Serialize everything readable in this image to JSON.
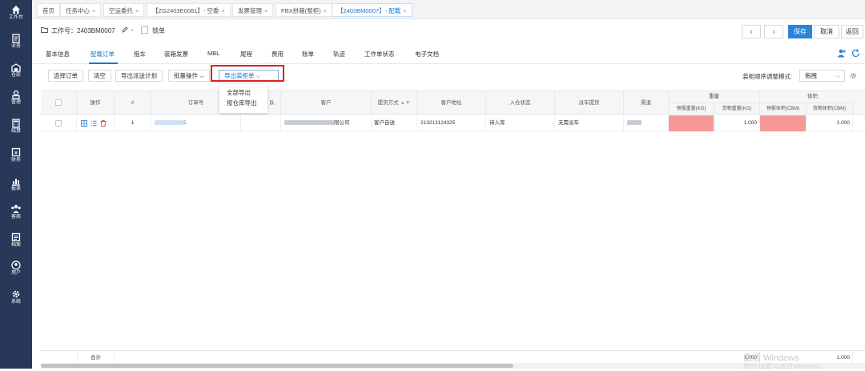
{
  "sidebar": {
    "items": [
      {
        "label": "工作台",
        "icon": "home-icon"
      },
      {
        "label": "业务",
        "icon": "document-icon"
      },
      {
        "label": "仓库",
        "icon": "warehouse-icon"
      },
      {
        "label": "管理",
        "icon": "manage-icon"
      },
      {
        "label": "结算",
        "icon": "calculator-icon"
      },
      {
        "label": "财务",
        "icon": "finance-icon"
      },
      {
        "label": "报表",
        "icon": "report-icon"
      },
      {
        "label": "客商",
        "icon": "people-icon"
      },
      {
        "label": "档案",
        "icon": "archive-icon"
      },
      {
        "label": "用户",
        "icon": "user-icon"
      },
      {
        "label": "系统",
        "icon": "gear-icon"
      }
    ]
  },
  "tabs": [
    {
      "label": "首页",
      "closable": false
    },
    {
      "label": "任务中心",
      "closable": true
    },
    {
      "label": "空运委托",
      "closable": true
    },
    {
      "label": "【ZG2403E0081】- 空委",
      "closable": true
    },
    {
      "label": "发票管理",
      "closable": true
    },
    {
      "label": "FBX拼箱(整柜)",
      "closable": true
    },
    {
      "label": "【2403BM0007】- 配载",
      "closable": true,
      "active": true
    }
  ],
  "header": {
    "work_order": "工作号：2403BM0007",
    "dash": "-",
    "lock_label": "锁单",
    "prev": "‹",
    "next": "›",
    "save": "保存",
    "cancel": "取消",
    "back": "返回"
  },
  "nav_tabs": [
    "基本信息",
    "配载订单",
    "拖车",
    "装箱发票",
    "MBL",
    "尾程",
    "费用",
    "账单",
    "轨迹",
    "工作单状态",
    "电子文档"
  ],
  "toolbar": {
    "select_order": "选择订单",
    "clear": "清空",
    "export_dispatch": "导出派送计划",
    "batch": "批量操作",
    "export_packing": "导出装柜单",
    "order_mode_label": "装柜顺序调整模式:",
    "order_mode_value": "拖拽"
  },
  "dropdown": [
    "全部导出",
    "按仓库导出"
  ],
  "table": {
    "headers": {
      "ops": "操作",
      "no": "#",
      "order_no": "订单号",
      "hidden": "队",
      "customer": "客户",
      "pickup": "提货方式",
      "cust_addr": "客户地址",
      "in_status": "入仓状态",
      "dispatch": "派车提货",
      "channel": "渠道",
      "weight": "重量",
      "forecast_weight": "预报重量(KG)",
      "goods_weight": "货物重量(KG)",
      "volume": "体积",
      "forecast_volume": "预报体积(CBM)",
      "goods_volume": "货物体积(CBM)"
    },
    "rows": [
      {
        "no": "1",
        "order_tail": "5",
        "customer_tail": "限公司",
        "pickup": "客户自送",
        "cust_addr": "213213124325",
        "in_status": "待入库",
        "dispatch": "无需派车",
        "goods_weight": "1.000",
        "goods_volume": "1.000"
      }
    ],
    "footer": {
      "label": "合计",
      "goods_weight": "1.000",
      "goods_volume": "1.000"
    }
  },
  "watermark": {
    "line1": "激活 Windows",
    "line2": "转到\"设置\"以激活 Windows。"
  },
  "colors": {
    "sidebar_bg": "#293859",
    "accent": "#1677d2",
    "highlight_box": "#e02020",
    "pink_cell": "#f59a98"
  }
}
